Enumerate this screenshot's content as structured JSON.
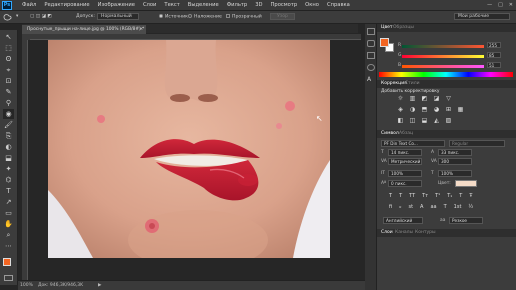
{
  "app": {
    "logo": "Ps"
  },
  "menu": [
    "Файл",
    "Редактирование",
    "Изображение",
    "Слои",
    "Текст",
    "Выделение",
    "Фильтр",
    "3D",
    "Просмотр",
    "Окно",
    "Справка"
  ],
  "window_controls": [
    "—",
    "□",
    "✕"
  ],
  "options": {
    "tolerance_label": "Допуск:",
    "tolerance_value": "Нормальный",
    "source_label": "Источник",
    "pattern_label": "Наложение",
    "transparent_label": "Прозрачный",
    "diffuse_button": "Узор",
    "workspace": "Мои рабочие"
  },
  "document": {
    "tab": "Проснутые_прыщи на-лице.jpg @ 100% (RGB/8#) *",
    "close": "×"
  },
  "status": {
    "zoom": "100%",
    "doc_info": "Док: 946,3K/946,3K",
    "arrow": "▶"
  },
  "tools": [
    "↖",
    "⬚",
    "ʘ",
    "⌖",
    "⊡",
    "✎",
    "⚲",
    "◉",
    "🖌",
    "⎘",
    "◐",
    "⬓",
    "✦",
    "⌬",
    "T",
    "↗",
    "▭",
    "✋",
    "⌕",
    "⋯"
  ],
  "color_panel": {
    "tab_active": "Цвет",
    "tab_inactive": "Образцы",
    "channels": [
      {
        "label": "R",
        "value": "255",
        "color": "#ff6a3a"
      },
      {
        "label": "G",
        "value": "85",
        "color": "#56ff3a"
      },
      {
        "label": "B",
        "value": "51",
        "color": "#3a6aff"
      }
    ]
  },
  "adjustments_panel": {
    "tab_active": "Коррекция",
    "tab_inactive": "Стили",
    "title": "Добавить корректировку",
    "row1": [
      "☼",
      "▥",
      "◩",
      "◪",
      "▽"
    ],
    "row2": [
      "◈",
      "◑",
      "⬒",
      "◕",
      "⊞",
      "▦"
    ],
    "row3": [
      "◧",
      "◫",
      "⬓",
      "◭",
      "▨"
    ]
  },
  "character_panel": {
    "tab_active": "Символ",
    "tab_inactive": "Абзац",
    "font": "PF Din Text Co...",
    "style": "Regular",
    "size": "14 пикс.",
    "leading": "33 пикс.",
    "kerning": "Метрический",
    "tracking": "300",
    "vscale": "100%",
    "hscale": "100%",
    "baseline": "0 пикс.",
    "color_label": "Цвет:",
    "language": "Английский",
    "aa_label": "aa",
    "aa_value": "Резкое",
    "styles": [
      "T",
      "T",
      "TT",
      "Tт",
      "T¹",
      "T₁",
      "T",
      "Ŧ"
    ],
    "extras": [
      "fi",
      "ℴ",
      "st",
      "A",
      "aa",
      "T",
      "1st",
      "½"
    ]
  },
  "layers_panel": {
    "tab_active": "Слои",
    "tab2": "Каналы",
    "tab3": "Контуры"
  },
  "colors": {
    "foreground": "#f26522",
    "background": "#ffffff",
    "text_color": "#f5dcc8",
    "accent": "#31a8ff"
  }
}
